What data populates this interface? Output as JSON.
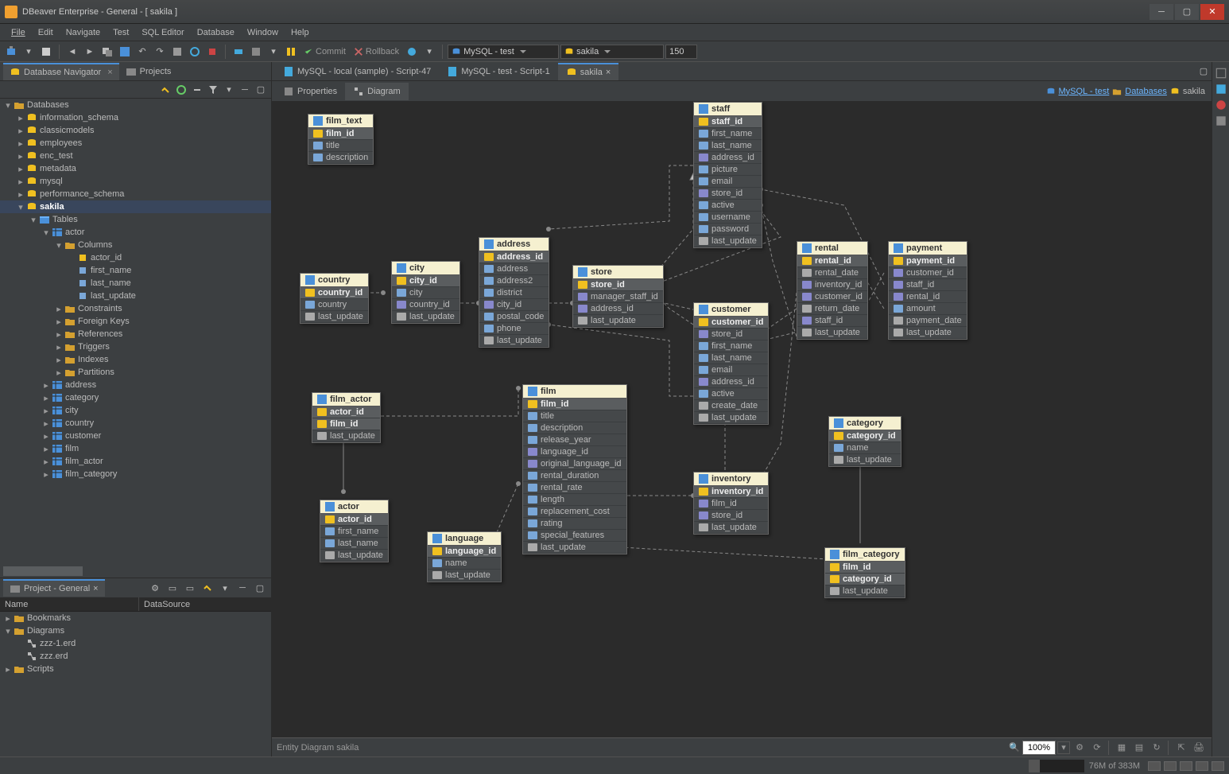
{
  "titlebar": {
    "title": "DBeaver Enterprise - General - [ sakila ]"
  },
  "menu": [
    "File",
    "Edit",
    "Navigate",
    "Test",
    "SQL Editor",
    "Database",
    "Window",
    "Help"
  ],
  "toolbar": {
    "commit": "Commit",
    "rollback": "Rollback",
    "datasource": "MySQL - test",
    "schema": "sakila",
    "rows": "150"
  },
  "nav_tabs": {
    "db": "Database Navigator",
    "projects": "Projects"
  },
  "tree": {
    "root": "Databases",
    "dbs": [
      "information_schema",
      "classicmodels",
      "employees",
      "enc_test",
      "metadata",
      "mysql",
      "performance_schema"
    ],
    "active_db": "sakila",
    "tables_label": "Tables",
    "active_table": "actor",
    "columns_label": "Columns",
    "actor_cols": [
      "actor_id",
      "first_name",
      "last_name",
      "last_update"
    ],
    "table_subfolders": [
      "Constraints",
      "Foreign Keys",
      "References",
      "Triggers",
      "Indexes",
      "Partitions"
    ],
    "other_tables": [
      "address",
      "category",
      "city",
      "country",
      "customer",
      "film",
      "film_actor",
      "film_category"
    ]
  },
  "project": {
    "title": "Project - General",
    "col1": "Name",
    "col2": "DataSource",
    "bookmarks": "Bookmarks",
    "diagrams": "Diagrams",
    "d1": "zzz-1.erd",
    "d2": "zzz.erd",
    "scripts": "Scripts"
  },
  "editor_tabs": {
    "t1": "MySQL - local (sample) - Script-47",
    "t2": "MySQL - test - Script-1",
    "t3": "sakila"
  },
  "sub_tabs": {
    "props": "Properties",
    "diagram": "Diagram"
  },
  "breadcrumb": {
    "conn": "MySQL - test",
    "dbs": "Databases",
    "db": "sakila"
  },
  "canvas_status": {
    "label": "Entity Diagram sakila",
    "zoom": "100%"
  },
  "status": {
    "mem": "76M of 383M"
  },
  "entities": {
    "film_text": {
      "name": "film_text",
      "pk": [
        "film_id"
      ],
      "cols": [
        "title",
        "description"
      ]
    },
    "country": {
      "name": "country",
      "pk": [
        "country_id"
      ],
      "cols": [
        "country",
        "last_update"
      ]
    },
    "city": {
      "name": "city",
      "pk": [
        "city_id"
      ],
      "cols": [
        "city",
        "country_id",
        "last_update"
      ]
    },
    "address": {
      "name": "address",
      "pk": [
        "address_id"
      ],
      "cols": [
        "address",
        "address2",
        "district",
        "city_id",
        "postal_code",
        "phone",
        "last_update"
      ]
    },
    "store": {
      "name": "store",
      "pk": [
        "store_id"
      ],
      "cols": [
        "manager_staff_id",
        "address_id",
        "last_update"
      ]
    },
    "staff": {
      "name": "staff",
      "pk": [
        "staff_id"
      ],
      "cols": [
        "first_name",
        "last_name",
        "address_id",
        "picture",
        "email",
        "store_id",
        "active",
        "username",
        "password",
        "last_update"
      ]
    },
    "rental": {
      "name": "rental",
      "pk": [
        "rental_id"
      ],
      "cols": [
        "rental_date",
        "inventory_id",
        "customer_id",
        "return_date",
        "staff_id",
        "last_update"
      ]
    },
    "payment": {
      "name": "payment",
      "pk": [
        "payment_id"
      ],
      "cols": [
        "customer_id",
        "staff_id",
        "rental_id",
        "amount",
        "payment_date",
        "last_update"
      ]
    },
    "customer": {
      "name": "customer",
      "pk": [
        "customer_id"
      ],
      "cols": [
        "store_id",
        "first_name",
        "last_name",
        "email",
        "address_id",
        "active",
        "create_date",
        "last_update"
      ]
    },
    "film_actor": {
      "name": "film_actor",
      "pk": [
        "actor_id",
        "film_id"
      ],
      "cols": [
        "last_update"
      ]
    },
    "actor": {
      "name": "actor",
      "pk": [
        "actor_id"
      ],
      "cols": [
        "first_name",
        "last_name",
        "last_update"
      ]
    },
    "language": {
      "name": "language",
      "pk": [
        "language_id"
      ],
      "cols": [
        "name",
        "last_update"
      ]
    },
    "film": {
      "name": "film",
      "pk": [
        "film_id"
      ],
      "cols": [
        "title",
        "description",
        "release_year",
        "language_id",
        "original_language_id",
        "rental_duration",
        "rental_rate",
        "length",
        "replacement_cost",
        "rating",
        "special_features",
        "last_update"
      ]
    },
    "inventory": {
      "name": "inventory",
      "pk": [
        "inventory_id"
      ],
      "cols": [
        "film_id",
        "store_id",
        "last_update"
      ]
    },
    "category": {
      "name": "category",
      "pk": [
        "category_id"
      ],
      "cols": [
        "name",
        "last_update"
      ]
    },
    "film_category": {
      "name": "film_category",
      "pk": [
        "film_id",
        "category_id"
      ],
      "cols": [
        "last_update"
      ]
    }
  }
}
